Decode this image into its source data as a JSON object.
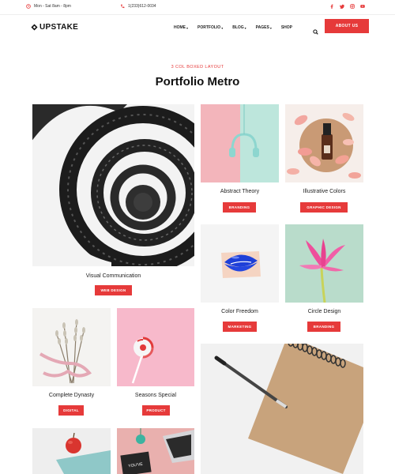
{
  "topbar": {
    "hours": "Mon - Sat 8am - 8pm",
    "phone": "1(233)612-0034",
    "social_icons": [
      "facebook-icon",
      "twitter-icon",
      "instagram-icon",
      "youtube-icon"
    ]
  },
  "header": {
    "logo": "UPSTAKE",
    "nav": [
      {
        "label": "HOME",
        "dropdown": true
      },
      {
        "label": "PORTFOLIO",
        "dropdown": true
      },
      {
        "label": "BLOG",
        "dropdown": true
      },
      {
        "label": "PAGES",
        "dropdown": true
      },
      {
        "label": "SHOP",
        "dropdown": false
      }
    ],
    "cta": "ABOUT US"
  },
  "intro": {
    "eyebrow": "3 COL BOXED LAYOUT",
    "title": "Portfolio Metro"
  },
  "portfolio": [
    {
      "title": "Visual Communication",
      "tag": "WEB DESIGN",
      "image": "spiral-staircase"
    },
    {
      "title": "Abstract Theory",
      "tag": "BRANDING",
      "image": "headphones-on-pink-mint"
    },
    {
      "title": "Illustrative Colors",
      "tag": "GRAPHIC DESIGN",
      "image": "bottle-and-petals"
    },
    {
      "title": "Color Freedom",
      "tag": "MARKETING",
      "image": "blue-lips"
    },
    {
      "title": "Circle Design",
      "tag": "BRANDING",
      "image": "pink-lily"
    },
    {
      "title": "Complete Dynasty",
      "tag": "DIGITAL",
      "image": "dried-flowers-ribbon"
    },
    {
      "title": "Seasons Special",
      "tag": "PRODUCT",
      "image": "lollipop-on-pink"
    },
    {
      "title": "",
      "tag": "",
      "image": "notebook-and-pen"
    },
    {
      "title": "",
      "tag": "",
      "image": "apple-and-book"
    },
    {
      "title": "",
      "tag": "",
      "image": "laptop-desk"
    }
  ],
  "colors": {
    "accent": "#e63a3a",
    "text": "#222222"
  }
}
